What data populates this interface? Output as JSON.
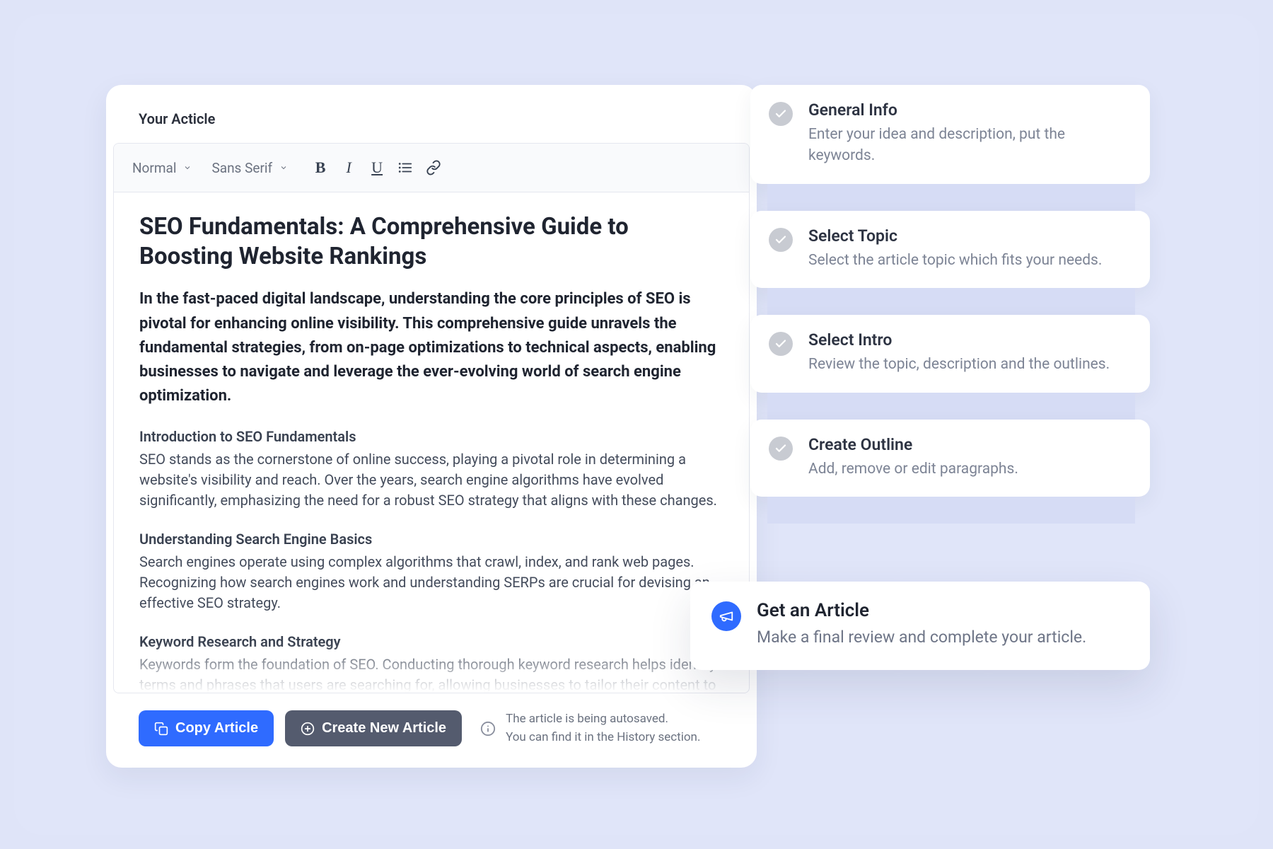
{
  "editor": {
    "label": "Your Acticle",
    "toolbar": {
      "textStyle": "Normal",
      "fontFamily": "Sans Serif"
    },
    "article": {
      "title": "SEO Fundamentals: A Comprehensive Guide to Boosting Website Rankings",
      "lead": "In the fast-paced digital landscape, understanding the core principles of SEO is pivotal for enhancing online visibility. This comprehensive guide unravels the fundamental strategies, from on-page optimizations to technical aspects, enabling businesses to navigate and leverage the ever-evolving world of search engine optimization.",
      "sections": [
        {
          "heading": "Introduction to SEO Fundamentals",
          "body": "SEO stands as the cornerstone of online success, playing a pivotal role in determining a website's visibility and reach. Over the years, search engine algorithms have evolved significantly, emphasizing the need for a robust SEO strategy that aligns with these changes."
        },
        {
          "heading": "Understanding Search Engine Basics",
          "body": "Search engines operate using complex algorithms that crawl, index, and rank web pages. Recognizing how search engines work and understanding SERPs are crucial for devising an effective SEO strategy."
        },
        {
          "heading": "Keyword Research and Strategy",
          "body": "Keywords form the foundation of SEO. Conducting thorough keyword research helps identify terms and phrases that users are searching for, allowing businesses to tailor their content to match user intent."
        }
      ]
    },
    "footer": {
      "copyArticle": "Copy Article",
      "createNew": "Create New Article",
      "autosaveLine1": "The article is being autosaved.",
      "autosaveLine2": "You can find it in the History section."
    }
  },
  "steps": [
    {
      "title": "General Info",
      "desc": "Enter your idea and description, put the keywords."
    },
    {
      "title": "Select Topic",
      "desc": "Select the article topic which fits your needs."
    },
    {
      "title": "Select Intro",
      "desc": "Review the topic, description and the outlines."
    },
    {
      "title": "Create Outline",
      "desc": "Add, remove or edit paragraphs."
    },
    {
      "title": "Get an Article",
      "desc": "Make a final review and complete your article."
    }
  ]
}
